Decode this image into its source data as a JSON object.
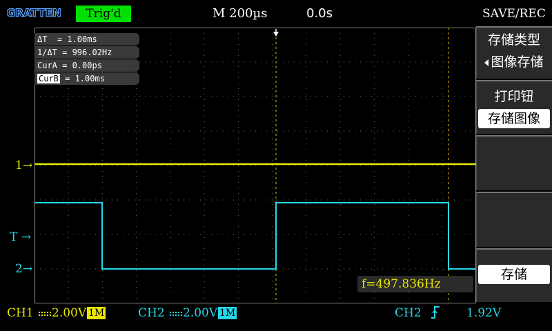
{
  "header": {
    "brand": "GRATTEN",
    "trigger_status": "Trig'd",
    "timebase": "M 200µs",
    "trigger_offset": "0.0s"
  },
  "cursor_info": {
    "delta_t": "ΔT  = 1.00ms",
    "inv_delta_t": "1/ΔT = 996.02Hz",
    "cur_a": "CurA = 0.00ps",
    "cur_b_tag": "CurB",
    "cur_b_value": " = 1.00ms"
  },
  "markers": {
    "ch1": "1",
    "trigger": "T",
    "ch2": "2"
  },
  "frequency": "f=497.836Hz",
  "status_bar": {
    "ch1_label": "CH1",
    "ch1_scale": "2.00V",
    "ch1_impedance": "1M",
    "ch2_label": "CH2",
    "ch2_scale": "2.00V",
    "ch2_impedance": "1M",
    "trigger_source": "CH2",
    "trigger_level": "1.92V"
  },
  "menu": {
    "title": "SAVE/REC",
    "storage_type_label": "存储类型",
    "storage_type_value": "图像存储",
    "print_key_label": "打印钮",
    "print_key_value": "存储图像",
    "save_button": "存储"
  },
  "colors": {
    "ch1": "#e8e800",
    "ch2": "#25d8e8",
    "trigger_badge": "#00e000"
  },
  "icons": {
    "trigger_edge": "rising-edge-icon",
    "submenu_arrow": "left-triangle-icon"
  }
}
